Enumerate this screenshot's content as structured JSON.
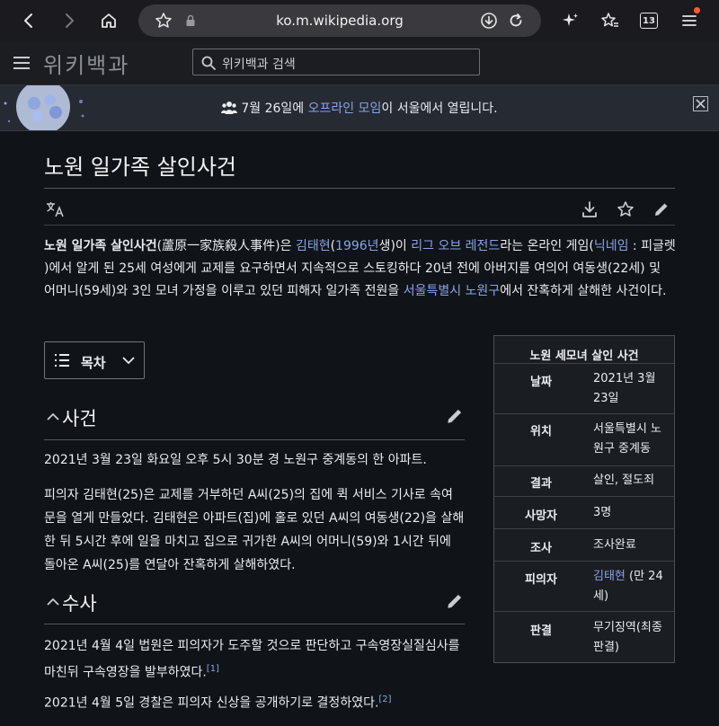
{
  "browser": {
    "url": "ko.m.wikipedia.org",
    "tab_count": "13"
  },
  "wiki": {
    "wordmark": "위키백과",
    "search_placeholder": "위키백과 검색"
  },
  "banner": {
    "text_before": "7월 26일에 ",
    "link": "오프라인 모임",
    "text_after": "이 서울에서 열립니다."
  },
  "article": {
    "title": "노원 일가족 살인사건",
    "lead": {
      "bold": "노원 일가족 살인사건",
      "t1": "(蘆原一家族殺人事件)은 ",
      "l1": "김태현",
      "t2": "(",
      "l2": "1996년",
      "t3": "생)이 ",
      "l3": "리그 오브 레전드",
      "t4": "라는 온라인 게임(",
      "l4": "닉네임",
      "t5": " : 피글렛 )에서 알게 된 25세 여성에게 교제를 요구하면서 지속적으로 스토킹하다 20년 전에 아버지를 여의어 여동생(22세) 및 어머니(59세)와 3인 모녀 가정을 이루고 있던 피해자 일가족 전원을 ",
      "l5": "서울특별시 노원구",
      "t6": "에서 잔혹하게 살해한 사건이다."
    },
    "toc_label": "목차",
    "sections": [
      {
        "title": "사건",
        "paragraphs": [
          "2021년 3월 23일 화요일 오후 5시 30분 경 노원구 중계동의 한 아파트.",
          "피의자 김태현(25)은 교제를 거부하던 A씨(25)의 집에 퀵 서비스 기사로 속여 문을 열게 만들었다. 김태현은 아파트(집)에 홀로 있던 A씨의 여동생(22)을 살해한 뒤 5시간 후에 일을 마치고 집으로 귀가한 A씨의 어머니(59)와 1시간 뒤에 돌아온 A씨(25)를 연달아 잔혹하게 살해하였다."
        ]
      },
      {
        "title": "수사",
        "paragraphs": [
          {
            "text": "2021년 4월 4일 법원은 피의자가 도주할 것으로 판단하고 구속영장실질심사를 마친뒤 구속영장을 발부하였다.",
            "ref": "[1]"
          },
          {
            "text": "2021년 4월 5일 경찰은 피의자 신상을 공개하기로 결정하였다.",
            "ref": "[2]"
          }
        ]
      }
    ]
  },
  "infobox": {
    "title": "노원 세모녀 살인 사건",
    "rows": [
      {
        "key": "날짜",
        "value": "2021년 3월 23일"
      },
      {
        "key": "위치",
        "value": "서울특별시 노원구 중계동"
      },
      {
        "key": "결과",
        "value": "살인, 절도죄"
      },
      {
        "key": "사망자",
        "value": "3명"
      },
      {
        "key": "조사",
        "value": "조사완료"
      },
      {
        "key": "피의자",
        "value_link": "김태현",
        "value_rest": " (만 24세)"
      },
      {
        "key": "판결",
        "value": "무기징역(최종판결)"
      }
    ]
  },
  "colors": {
    "link": "#88a3e8",
    "background": "#101418",
    "text": "#eaecf0"
  }
}
